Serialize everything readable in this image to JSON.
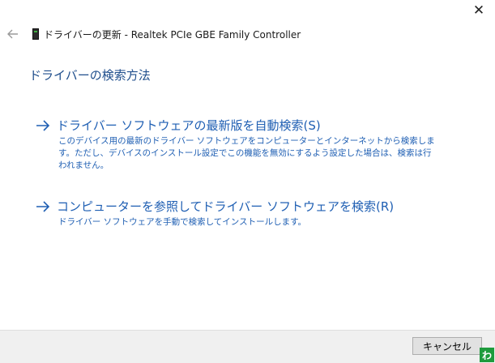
{
  "window": {
    "close_glyph": "✕",
    "title": "ドライバーの更新 - Realtek PCIe GBE Family Controller"
  },
  "page": {
    "heading": "ドライバーの検索方法"
  },
  "options": [
    {
      "title": "ドライバー ソフトウェアの最新版を自動検索(S)",
      "description": "このデバイス用の最新のドライバー ソフトウェアをコンピューターとインターネットから検索します。ただし、デバイスのインストール設定でこの機能を無効にするよう設定した場合は、検索は行われません。"
    },
    {
      "title": "コンピューターを参照してドライバー ソフトウェアを検索(R)",
      "description": "ドライバー ソフトウェアを手動で検索してインストールします。"
    }
  ],
  "footer": {
    "cancel_label": "キャンセル",
    "badge_char": "わ"
  },
  "colors": {
    "accent": "#1f5fb3",
    "heading": "#1f4e8c",
    "footer_bg": "#f0f0f0"
  },
  "icons": {
    "back": "back-arrow-icon",
    "device": "network-adapter-icon",
    "option_arrow": "right-arrow-icon"
  }
}
